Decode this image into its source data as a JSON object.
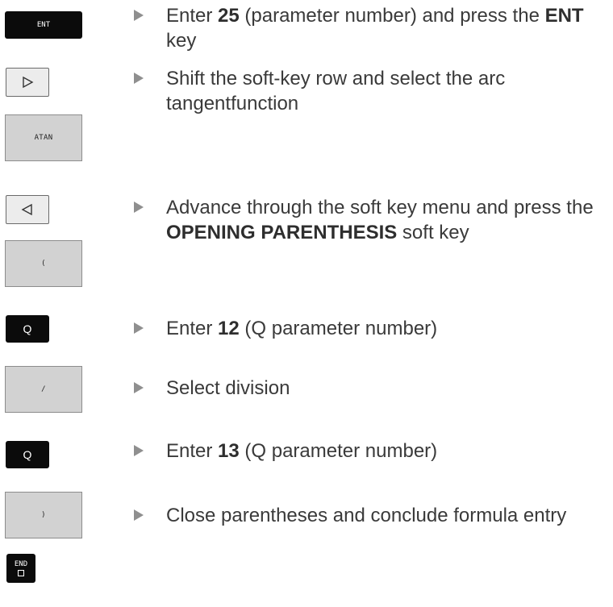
{
  "keys": {
    "ent": "ENT",
    "atan": "ATAN",
    "open_paren": "(",
    "q1": "Q",
    "divide": "/",
    "q2": "Q",
    "close_paren": ")",
    "end": "END"
  },
  "steps": [
    {
      "pre": "Enter ",
      "bold": "25",
      "mid": " (parameter number) and press the ",
      "bold2": "ENT",
      "post": " key"
    },
    {
      "text": "Shift the soft-key row and select the arc tangentfunction"
    },
    {
      "pre": "Advance through the soft key menu and press the ",
      "bold": "OPENING PARENTHESIS",
      "post": " soft key"
    },
    {
      "pre": "Enter ",
      "bold": "12",
      "post": " (Q parameter number)"
    },
    {
      "text": "Select division"
    },
    {
      "pre": "Enter ",
      "bold": "13",
      "post": " (Q parameter number)"
    },
    {
      "text": "Close parentheses and conclude formula entry"
    }
  ],
  "colors": {
    "text": "#3a3a3a",
    "arrow": "#8f8f8f",
    "key_black": "#0b0b0b",
    "soft_key": "#d2d2d2"
  }
}
